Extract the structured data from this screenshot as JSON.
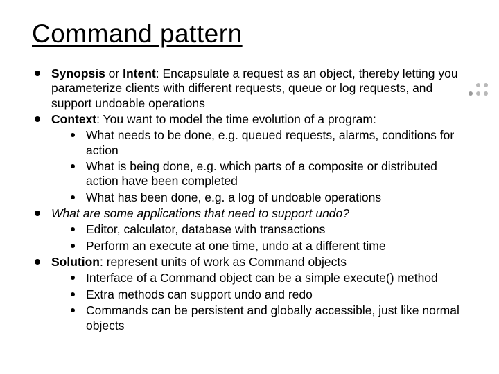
{
  "title": "Command pattern",
  "b1": {
    "lead": "Synopsis",
    "mid": " or ",
    "lead2": "Intent",
    "rest": ": Encapsulate a request as an object, thereby letting you parameterize clients with different requests, queue or log requests, and support undoable operations"
  },
  "b2": {
    "lead": "Context",
    "rest": ": You want to model the time evolution of a program:",
    "s1": "What needs to be done, e.g. queued requests, alarms, conditions for action",
    "s2": "What is being done, e.g. which parts of a composite or distributed action have been completed",
    "s3": "What has been done, e.g. a log of undoable operations"
  },
  "b3": {
    "q": "What are some applications that need to support undo?",
    "s1": "Editor, calculator, database with transactions",
    "s2": "Perform an execute at one time, undo at a different time"
  },
  "b4": {
    "lead": "Solution",
    "rest": ": represent units of work as Command objects",
    "s1": "Interface of a Command object can be a simple execute() method",
    "s2": "Extra methods can support undo and redo",
    "s3": "Commands can be persistent and globally accessible, just like normal objects"
  }
}
